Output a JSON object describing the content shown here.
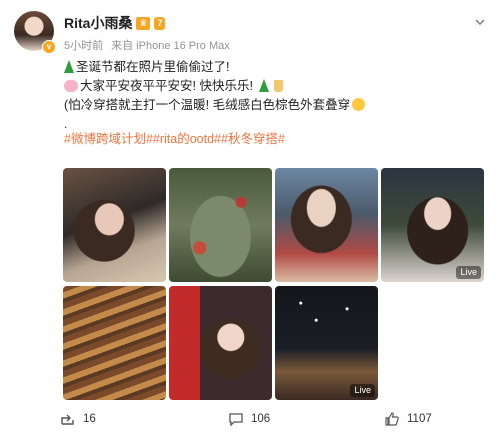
{
  "user": {
    "name": "Rita小雨桑",
    "vip_label": "7",
    "time": "5小时前",
    "source": "来自 iPhone 16 Pro Max"
  },
  "post": {
    "line1": "圣诞节都在照片里偷偷过了!",
    "line2": "大家平安夜平平安安! 快快乐乐!",
    "line3": "(怕冷穿搭就主打一个温暖! 毛绒感白色棕色外套叠穿",
    "dot": ".",
    "hashtags": "#微博跨域计划##rita的ootd##秋冬穿搭#"
  },
  "photos": [
    {
      "live": ""
    },
    {
      "live": ""
    },
    {
      "live": ""
    },
    {
      "live": "Live"
    },
    {
      "live": ""
    },
    {
      "live": ""
    },
    {
      "live": "Live"
    }
  ],
  "actions": {
    "share_count": "16",
    "comment_count": "106",
    "like_count": "1107"
  },
  "colors": {
    "hashtag": "#eb7340",
    "vip": "#f5a623"
  }
}
